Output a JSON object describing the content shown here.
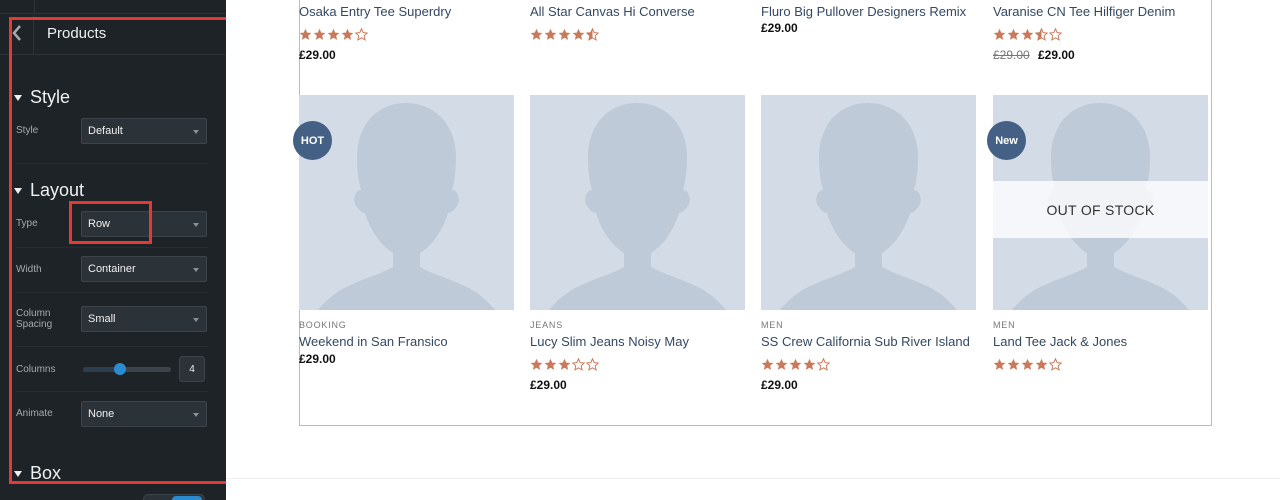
{
  "sidebar": {
    "title": "Products",
    "back_icon": "chevron-left-icon",
    "sections": {
      "style": {
        "heading": "Style",
        "style_label": "Style",
        "style_value": "Default"
      },
      "layout": {
        "heading": "Layout",
        "type_label": "Type",
        "type_value": "Row",
        "width_label": "Width",
        "width_value": "Container",
        "spacing_label": "Column Spacing",
        "spacing_value": "Small",
        "columns_label": "Columns",
        "columns_value": "4",
        "columns_slider_fraction": 0.42,
        "animate_label": "Animate",
        "animate_value": "None"
      },
      "box": {
        "heading": "Box"
      }
    }
  },
  "colors": {
    "sidebar_bg": "#1d2327",
    "highlight": "#e53935",
    "star": "#c97a5a",
    "badge": "#446084",
    "link": "#334862",
    "slider_knob": "#2a8bd0"
  },
  "products_top": [
    {
      "name": "Osaka Entry Tee Superdry",
      "rating": 4,
      "price": "£29.00"
    },
    {
      "name": "All Star Canvas Hi Converse",
      "rating": 4.5,
      "price": ""
    },
    {
      "name": "Fluro Big Pullover Designers Remix",
      "rating": 0,
      "price": "£29.00"
    },
    {
      "name": "Varanise CN Tee Hilfiger Denim",
      "rating": 3.5,
      "old_price": "£29.00",
      "price": "£29.00"
    }
  ],
  "products_bottom": [
    {
      "category": "BOOKING",
      "name": "Weekend in San Fransico",
      "rating": 0,
      "price": "£29.00",
      "badge": "HOT",
      "out_of_stock": ""
    },
    {
      "category": "JEANS",
      "name": "Lucy Slim Jeans Noisy May",
      "rating": 3,
      "price": "£29.00",
      "badge": "",
      "out_of_stock": ""
    },
    {
      "category": "MEN",
      "name": "SS Crew California Sub River Island",
      "rating": 4,
      "price": "£29.00",
      "badge": "",
      "out_of_stock": ""
    },
    {
      "category": "MEN",
      "name": "Land Tee Jack & Jones",
      "rating": 4,
      "price": "",
      "badge": "New",
      "out_of_stock": "OUT OF STOCK"
    }
  ]
}
